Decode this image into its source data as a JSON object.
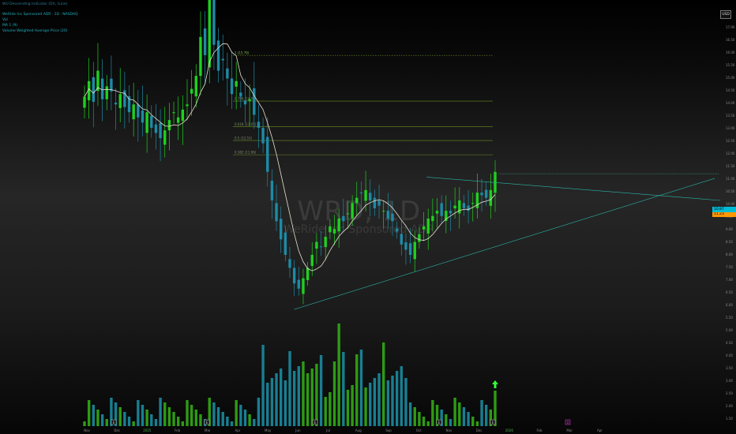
{
  "legend": {
    "line1": "WU Descending Indicator (DI), (Line)",
    "line2": "WeRide Inc Sponsored ADR · 1D · NASDAQ",
    "line3": "Vol",
    "line4": "MA 1 (9)",
    "line5": "Volume Weighted Average Price (20)"
  },
  "watermark": {
    "symbol": "WRD, 1D",
    "description": "WeRide Inc Sponsored ADR"
  },
  "currency": "USD",
  "fib_labels": [
    "1 (15.79)",
    "0.786 (14.03)",
    "0.618 (13.05)",
    "0.5 (12.51)",
    "0.382 (11.96)"
  ],
  "price_axis": [
    "17.00",
    "16.50",
    "16.00",
    "15.50",
    "15.00",
    "14.50",
    "14.00",
    "13.50",
    "13.00",
    "12.50",
    "12.00",
    "11.50",
    "11.00",
    "10.50",
    "10.00",
    "9.50",
    "9.00",
    "8.50",
    "8.00",
    "7.50",
    "7.00",
    "6.50",
    "6.00",
    "5.50",
    "5.00",
    "4.50",
    "4.00",
    "3.50",
    "3.00",
    "2.50",
    "2.00",
    "1.50"
  ],
  "price_tags": [
    "11.23",
    "10.87"
  ],
  "time_axis": [
    "Nov",
    "Dec",
    "2025",
    "Feb",
    "Mar",
    "Apr",
    "May",
    "Jun",
    "Jul",
    "Aug",
    "Sep",
    "Oct",
    "Nov",
    "Dec",
    "2026",
    "Feb",
    "Mar",
    "Apr"
  ],
  "event_markers": [
    "E",
    "E",
    "E",
    "E",
    "E",
    "D"
  ],
  "colors": {
    "up": "#1fd11f",
    "down": "#1e8aa6",
    "ma": "#e8e0d0",
    "trendline": "#2bb5a5",
    "fib": "#6b8e23",
    "volume_up": "#2e9b14",
    "volume_down": "#197e92"
  },
  "chart_data": {
    "type": "candlestick",
    "symbol": "WRD",
    "interval": "1D",
    "description": "WeRide Inc Sponsored ADR",
    "close": [
      14.2,
      14.8,
      14.0,
      15.2,
      14.1,
      14.6,
      14.4,
      13.9,
      14.3,
      13.8,
      13.6,
      13.9,
      13.4,
      13.2,
      13.6,
      13.0,
      12.8,
      12.6,
      12.9,
      13.3,
      13.6,
      13.4,
      13.7,
      13.9,
      14.5,
      15.0,
      16.5,
      15.8,
      19.4,
      16.2,
      15.2,
      15.6,
      14.9,
      14.3,
      14.8,
      14.2,
      13.9,
      14.1,
      13.5,
      13.0,
      12.4,
      11.3,
      10.2,
      9.4,
      8.7,
      8.1,
      7.6,
      7.0,
      6.8,
      7.2,
      7.6,
      8.1,
      8.6,
      8.4,
      8.8,
      9.2,
      9.1,
      9.5,
      9.4,
      9.7,
      10.1,
      10.3,
      10.5,
      10.6,
      10.2,
      9.9,
      10.0,
      9.8,
      9.5,
      9.4,
      9.0,
      8.5,
      8.3,
      8.1,
      8.6,
      8.9,
      9.2,
      9.5,
      9.6,
      9.8,
      9.6,
      9.8,
      9.7,
      10.0,
      10.2,
      9.9,
      9.8,
      10.1,
      10.5,
      10.4,
      10.3,
      10.6,
      11.3
    ],
    "volume_units": "relative",
    "price_tags": [
      11.23,
      10.87
    ],
    "fibonacci": [
      {
        "level": 1,
        "price": 15.79
      },
      {
        "level": 0.786,
        "price": 14.03
      },
      {
        "level": 0.618,
        "price": 13.05
      },
      {
        "level": 0.5,
        "price": 12.51
      },
      {
        "level": 0.382,
        "price": 11.96
      }
    ],
    "ylim": [
      1.5,
      17.5
    ]
  }
}
